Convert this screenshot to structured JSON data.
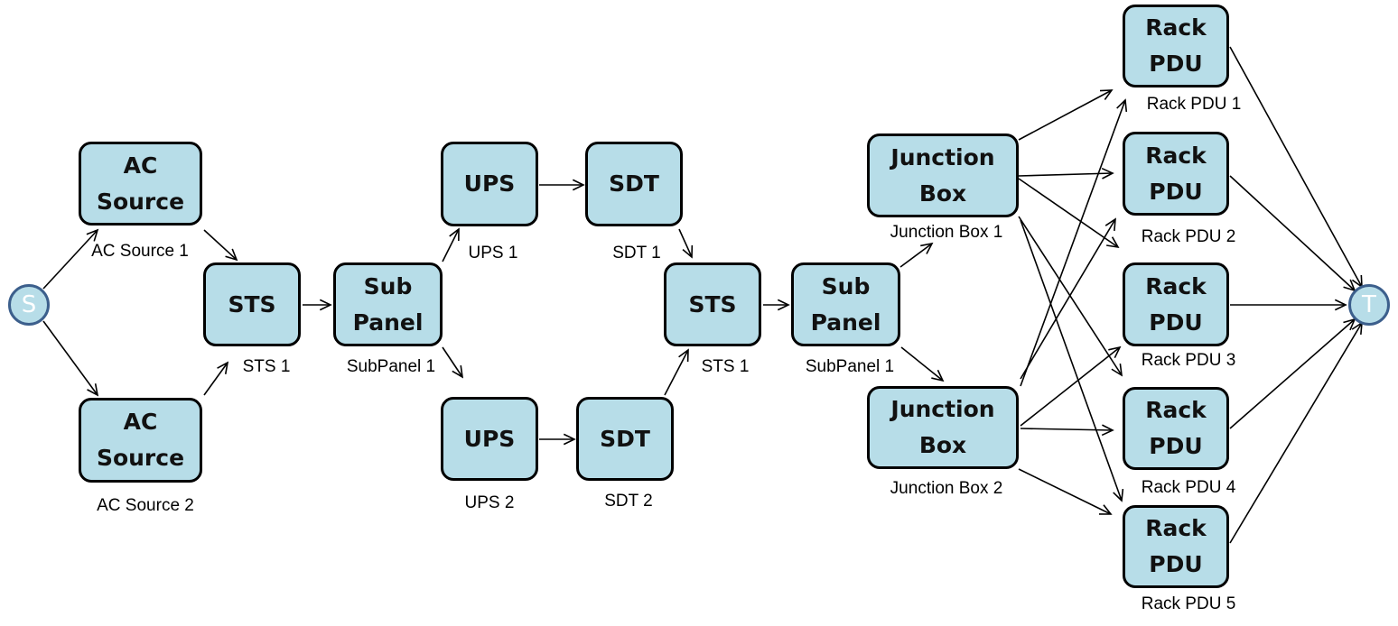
{
  "source": "S",
  "sink": "T",
  "nodes": [
    {
      "id": "ac1",
      "text": "AC\nSource",
      "label": "AC Source 1"
    },
    {
      "id": "ac2",
      "text": "AC\nSource",
      "label": "AC Source 2"
    },
    {
      "id": "sts1",
      "text": "STS",
      "label": "STS 1"
    },
    {
      "id": "sub1",
      "text": "Sub\nPanel",
      "label": "SubPanel 1"
    },
    {
      "id": "ups1",
      "text": "UPS",
      "label": "UPS 1"
    },
    {
      "id": "ups2",
      "text": "UPS",
      "label": "UPS 2"
    },
    {
      "id": "sdt1",
      "text": "SDT",
      "label": "SDT 1"
    },
    {
      "id": "sdt2",
      "text": "SDT",
      "label": "SDT 2"
    },
    {
      "id": "sts2",
      "text": "STS",
      "label": "STS 1"
    },
    {
      "id": "sub2",
      "text": "Sub\nPanel",
      "label": "SubPanel 1"
    },
    {
      "id": "jb1",
      "text": "Junction\nBox",
      "label": "Junction Box 1"
    },
    {
      "id": "jb2",
      "text": "Junction\nBox",
      "label": "Junction Box 2"
    },
    {
      "id": "pdu1",
      "text": "Rack\nPDU",
      "label": "Rack PDU 1"
    },
    {
      "id": "pdu2",
      "text": "Rack\nPDU",
      "label": "Rack PDU 2"
    },
    {
      "id": "pdu3",
      "text": "Rack\nPDU",
      "label": "Rack PDU 3"
    },
    {
      "id": "pdu4",
      "text": "Rack\nPDU",
      "label": "Rack PDU 4"
    },
    {
      "id": "pdu5",
      "text": "Rack\nPDU",
      "label": "Rack PDU 5"
    }
  ],
  "edges": [
    [
      "S",
      "ac1"
    ],
    [
      "S",
      "ac2"
    ],
    [
      "ac1",
      "sts1"
    ],
    [
      "ac2",
      "sts1"
    ],
    [
      "sts1",
      "sub1"
    ],
    [
      "sub1",
      "ups1"
    ],
    [
      "sub1",
      "ups2"
    ],
    [
      "ups1",
      "sdt1"
    ],
    [
      "ups2",
      "sdt2"
    ],
    [
      "sdt1",
      "sts2"
    ],
    [
      "sdt2",
      "sts2"
    ],
    [
      "sts2",
      "sub2"
    ],
    [
      "sub2",
      "jb1"
    ],
    [
      "sub2",
      "jb2"
    ],
    [
      "jb1",
      "pdu1"
    ],
    [
      "jb1",
      "pdu2"
    ],
    [
      "jb1",
      "pdu3"
    ],
    [
      "jb1",
      "pdu4"
    ],
    [
      "jb1",
      "pdu5"
    ],
    [
      "jb2",
      "pdu1"
    ],
    [
      "jb2",
      "pdu2"
    ],
    [
      "jb2",
      "pdu3"
    ],
    [
      "jb2",
      "pdu4"
    ],
    [
      "jb2",
      "pdu5"
    ],
    [
      "pdu1",
      "T"
    ],
    [
      "pdu2",
      "T"
    ],
    [
      "pdu3",
      "T"
    ],
    [
      "pdu4",
      "T"
    ],
    [
      "pdu5",
      "T"
    ]
  ]
}
